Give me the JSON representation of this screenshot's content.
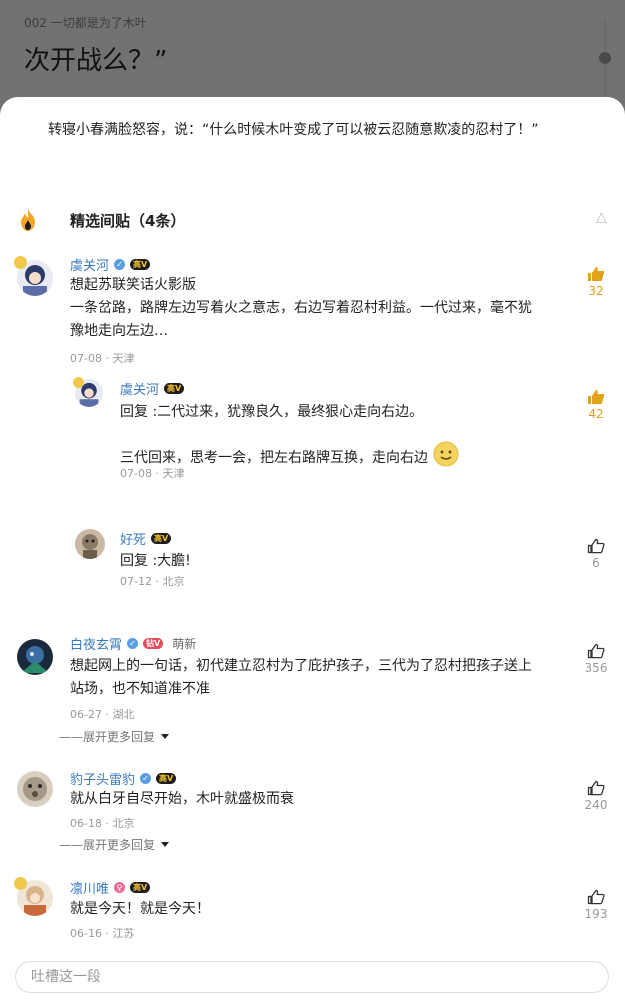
{
  "background_page": {
    "chapter_label": "002 一切都是为了木叶",
    "visible_text": "次开战么？”"
  },
  "sheet": {
    "quoted_paragraph": "转寝小春满脸怒容，说：“什么时候木叶变成了可以被云忍随意欺凌的忍村了！”",
    "section": {
      "title": "精选间贴（4条）",
      "icon": "fire-icon",
      "collapse_icon": "chevron-up-icon"
    }
  },
  "comments": [
    {
      "user": "虞关河",
      "level": "高V",
      "lines": [
        "想起苏联笑话火影版",
        "一条岔路，路牌左边写着火之意志，右边写着忍村利益。一代过来，毫不犹",
        "豫地走向左边…"
      ],
      "meta": "07-08 · 天津",
      "likes": "32",
      "reply": {
        "user": "虞关河",
        "level": "高V",
        "line1": "回复 :二代过来，犹豫良久，最终狠心走向右边。",
        "line2": "三代回来，思考一会，把左右路牌互换，走向右边",
        "meta": "07-08 · 天津",
        "likes": "42"
      }
    },
    {
      "user": "好死",
      "level": "高V",
      "body": "回复 :大膽!",
      "meta": "07-12 · 北京",
      "likes": "6"
    },
    {
      "user": "白夜玄霄",
      "level": "钻V",
      "tag": "萌新",
      "lines": [
        "想起网上的一句话，初代建立忍村为了庇护孩子，三代为了忍村把孩子送上",
        "站场，也不知道准不准"
      ],
      "meta": "06-27 · 湖北",
      "likes": "356",
      "expand": "——展开更多回复"
    },
    {
      "user": "豹子头雷豹",
      "level": "高V",
      "lines": [
        "就从白牙自尽开始，木叶就盛极而衰"
      ],
      "meta": "06-18 · 北京",
      "likes": "240",
      "expand": "——展开更多回复"
    },
    {
      "user": "凛川唯",
      "level": "高V",
      "lines": [
        "就是今天！就是今天！"
      ],
      "meta": "06-16 · 江苏",
      "likes": "193"
    }
  ],
  "input": {
    "placeholder": "吐槽这一段"
  },
  "colors": {
    "username": "#3a7bbf",
    "like_active": "#e0a21b",
    "accent_badge": "#1c1c1c"
  }
}
